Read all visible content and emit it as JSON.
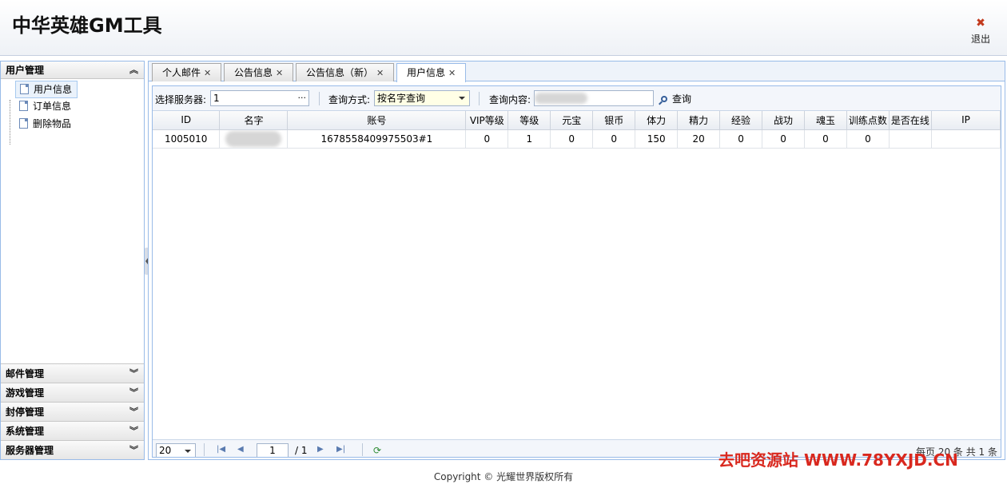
{
  "app": {
    "title": "中华英雄GM工具",
    "logout_label": "退出"
  },
  "sidebar": {
    "top_section": "用户管理",
    "items": [
      {
        "label": "用户信息",
        "selected": true
      },
      {
        "label": "订单信息",
        "selected": false
      },
      {
        "label": "删除物品",
        "selected": false
      }
    ],
    "sections": [
      {
        "label": "邮件管理"
      },
      {
        "label": "游戏管理"
      },
      {
        "label": "封停管理"
      },
      {
        "label": "系统管理"
      },
      {
        "label": "服务器管理"
      }
    ]
  },
  "tabs": [
    {
      "label": "个人邮件",
      "active": false
    },
    {
      "label": "公告信息",
      "active": false
    },
    {
      "label": "公告信息（新）",
      "active": false
    },
    {
      "label": "用户信息",
      "active": true
    }
  ],
  "toolbar": {
    "server_label": "选择服务器:",
    "server_value": "1",
    "server_button": "···",
    "method_label": "查询方式:",
    "method_value": "按名字查询",
    "content_label": "查询内容:",
    "content_value": "",
    "search_label": "查询"
  },
  "grid": {
    "columns": [
      "ID",
      "名字",
      "账号",
      "VIP等级",
      "等级",
      "元宝",
      "银币",
      "体力",
      "精力",
      "经验",
      "战功",
      "魂玉",
      "训练点数",
      "是否在线",
      "IP"
    ],
    "rows": [
      [
        "1005010",
        "",
        "1678558409975503#1",
        "0",
        "1",
        "0",
        "0",
        "150",
        "20",
        "0",
        "0",
        "0",
        "0",
        "",
        ""
      ]
    ]
  },
  "pager": {
    "page_size": "20",
    "page_number": "1",
    "page_total": "/ 1",
    "info": "每页 20 条 共 1 条"
  },
  "watermark": "去吧资源站 WWW.78YXJD.CN",
  "footer": "Copyright © 光耀世界版权所有"
}
